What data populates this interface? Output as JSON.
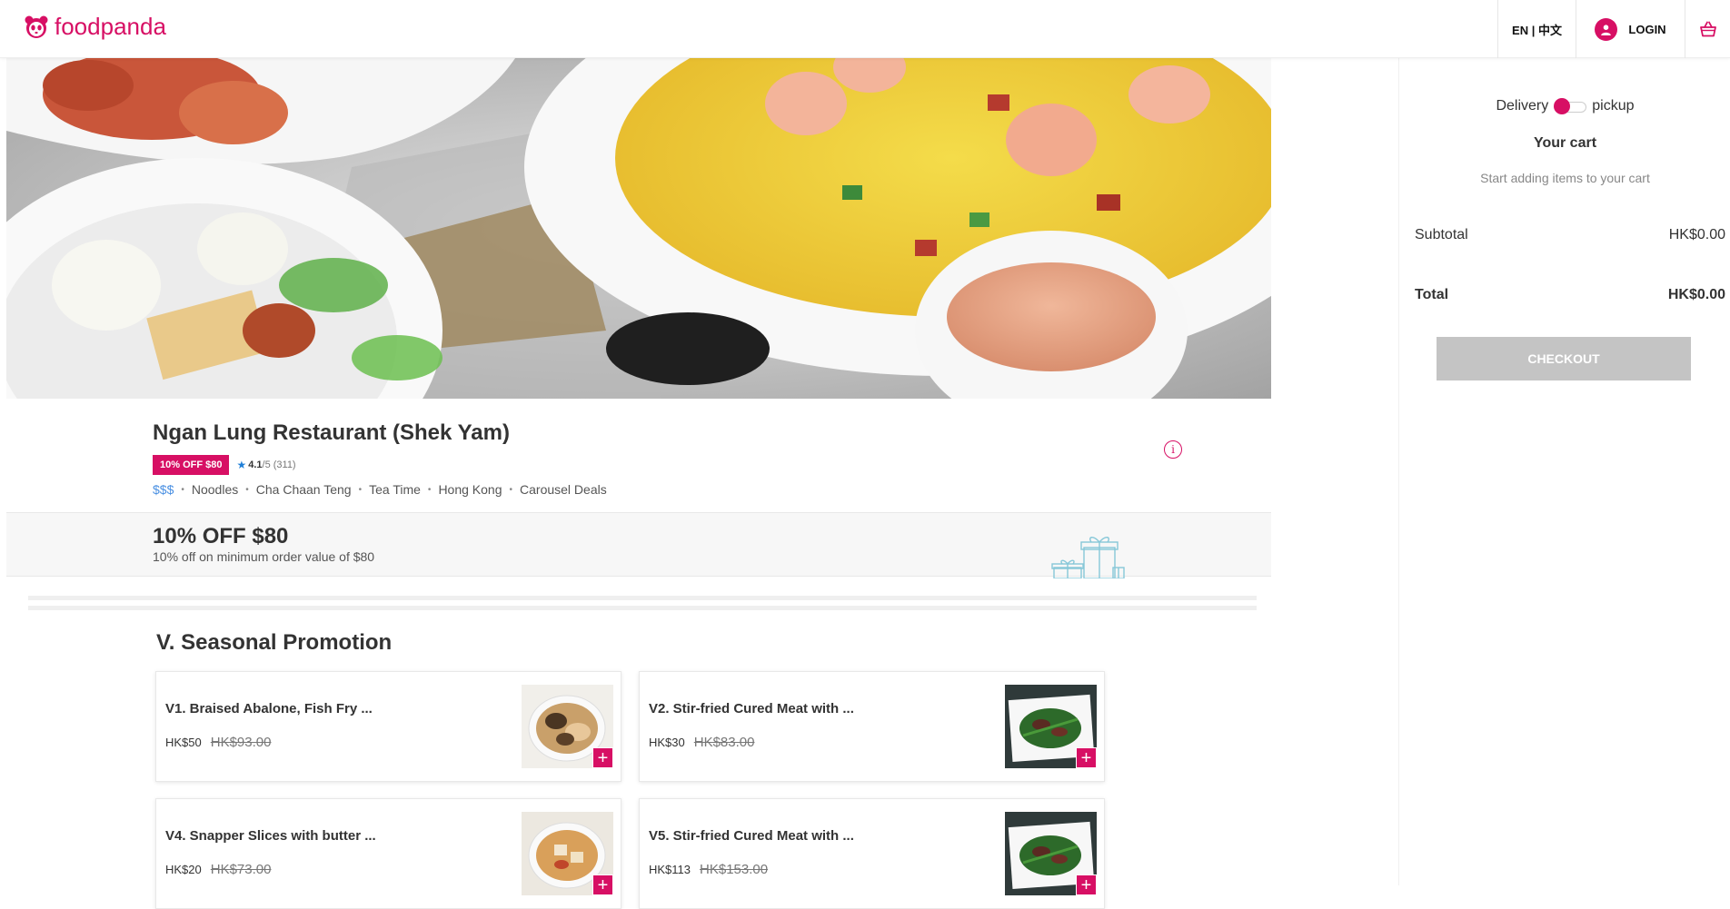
{
  "brand": {
    "name": "foodpanda",
    "color": "#d70f64"
  },
  "header": {
    "language": "EN | 中文",
    "login_label": "LOGIN",
    "cart_icon": "shopping-basket-icon"
  },
  "restaurant": {
    "name": "Ngan Lung Restaurant (Shek Yam)",
    "discount_badge": "10% OFF $80",
    "rating": "4.1",
    "rating_scale": "/5",
    "rating_count": "(311)",
    "price_level": "$$$",
    "tags": [
      "Noodles",
      "Cha Chaan Teng",
      "Tea Time",
      "Hong Kong",
      "Carousel Deals"
    ]
  },
  "deal": {
    "title": "10% OFF $80",
    "subtitle": "10% off on minimum order value of $80"
  },
  "menu": {
    "section_title": "V. Seasonal Promotion",
    "items": [
      {
        "name": "V1. Braised Abalone, Fish Fry ...",
        "price": "HK$50",
        "original_price": "HK$93.00",
        "image": "abalone-bowl"
      },
      {
        "name": "V2. Stir-fried Cured Meat with ...",
        "price": "HK$30",
        "original_price": "HK$83.00",
        "image": "cured-meat-greens"
      },
      {
        "name": "V4. Snapper Slices with butter ...",
        "price": "HK$20",
        "original_price": "HK$73.00",
        "image": "snapper-bowl"
      },
      {
        "name": "V5. Stir-fried Cured Meat with ...",
        "price": "HK$113",
        "original_price": "HK$153.00",
        "image": "cured-meat-greens"
      }
    ]
  },
  "cart": {
    "delivery_label": "Delivery",
    "pickup_label": "pickup",
    "title": "Your cart",
    "empty_text": "Start adding items to your cart",
    "subtotal_label": "Subtotal",
    "subtotal_value": "HK$0.00",
    "total_label": "Total",
    "total_value": "HK$0.00",
    "checkout_label": "CHECKOUT"
  }
}
